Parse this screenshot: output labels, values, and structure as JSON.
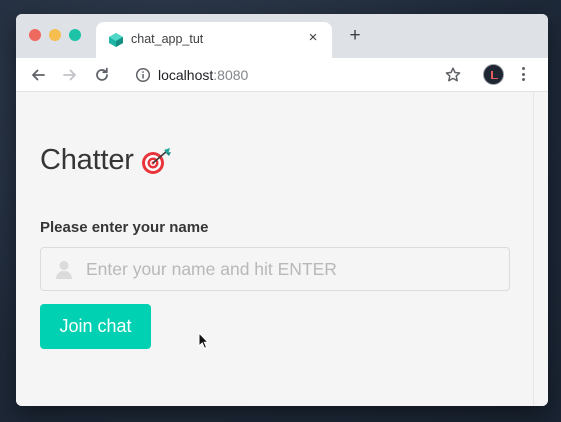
{
  "browser": {
    "tab": {
      "title": "chat_app_tut",
      "favicon": "cube-favicon-icon"
    },
    "close_label": "×",
    "new_tab_label": "+",
    "address": {
      "host": "localhost",
      "port": ":8080"
    },
    "icons": [
      "back-arrow-icon",
      "forward-arrow-icon",
      "reload-icon",
      "info-icon",
      "bookmark-star-icon",
      "profile-avatar",
      "more-menu-icon"
    ]
  },
  "page": {
    "title": "Chatter",
    "title_icon": "direct-hit-target-icon",
    "name_label": "Please enter your name",
    "name_input": {
      "value": "",
      "placeholder": "Enter your name and hit ENTER",
      "icon": "user-icon"
    },
    "join_button": "Join chat"
  },
  "colors": {
    "accent": "#00d1b2",
    "text": "#363636",
    "desktop_bg": "#243041",
    "page_bg": "#f5f5f5"
  }
}
